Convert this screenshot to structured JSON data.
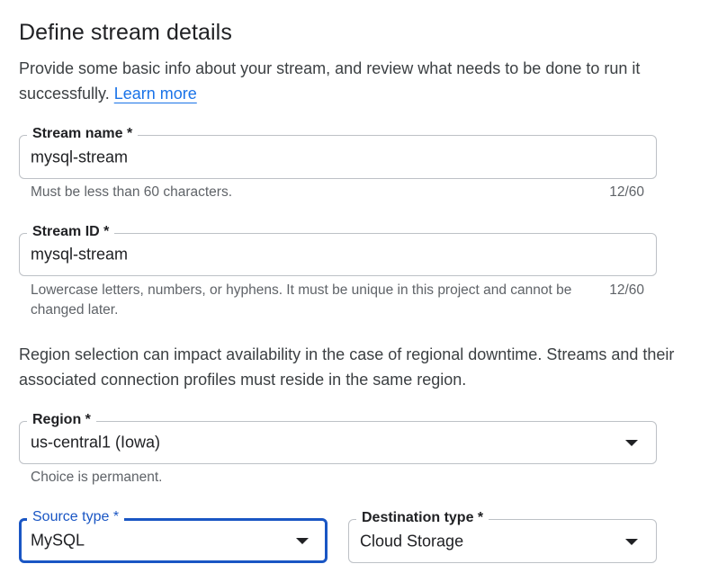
{
  "header": {
    "title": "Define stream details",
    "intro_text": "Provide some basic info about your stream, and review what needs to be done to run it successfully.",
    "learn_more": "Learn more"
  },
  "stream_name": {
    "label": "Stream name *",
    "value": "mysql-stream",
    "hint": "Must be less than 60 characters.",
    "counter": "12/60"
  },
  "stream_id": {
    "label": "Stream ID *",
    "value": "mysql-stream",
    "hint": "Lowercase letters, numbers, or hyphens. It must be unique in this project and cannot be changed later.",
    "counter": "12/60"
  },
  "region_note": "Region selection can impact availability in the case of regional downtime. Streams and their associated connection profiles must reside in the same region.",
  "region": {
    "label": "Region *",
    "value": "us-central1 (Iowa)",
    "hint": "Choice is permanent."
  },
  "source_type": {
    "label": "Source type *",
    "value": "MySQL"
  },
  "destination_type": {
    "label": "Destination type *",
    "value": "Cloud Storage"
  },
  "colors": {
    "accent": "#1a56c4",
    "link": "#1a73e8",
    "border": "#bdc1c6",
    "hint": "#5f6368"
  }
}
